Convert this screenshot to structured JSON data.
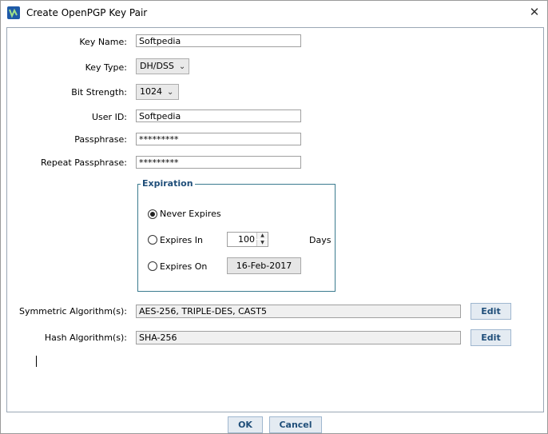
{
  "window": {
    "title": "Create OpenPGP Key Pair"
  },
  "form": {
    "key_name_label": "Key Name:",
    "key_name_value": "Softpedia",
    "key_type_label": "Key Type:",
    "key_type_value": "DH/DSS",
    "bit_strength_label": "Bit Strength:",
    "bit_strength_value": "1024",
    "user_id_label": "User ID:",
    "user_id_value": "Softpedia",
    "passphrase_label": "Passphrase:",
    "passphrase_value": "*********",
    "repeat_passphrase_label": "Repeat Passphrase:",
    "repeat_passphrase_value": "*********"
  },
  "expiration": {
    "title": "Expiration",
    "never_label": "Never Expires",
    "never_selected": true,
    "expires_in_label": "Expires In",
    "expires_in_value": "100",
    "days_label": "Days",
    "expires_on_label": "Expires On",
    "expires_on_value": "16-Feb-2017"
  },
  "algorithms": {
    "symmetric_label": "Symmetric Algorithm(s):",
    "symmetric_value": "AES-256, TRIPLE-DES, CAST5",
    "symmetric_edit": "Edit",
    "hash_label": "Hash Algorithm(s):",
    "hash_value": "SHA-256",
    "hash_edit": "Edit"
  },
  "buttons": {
    "ok": "OK",
    "cancel": "Cancel"
  }
}
